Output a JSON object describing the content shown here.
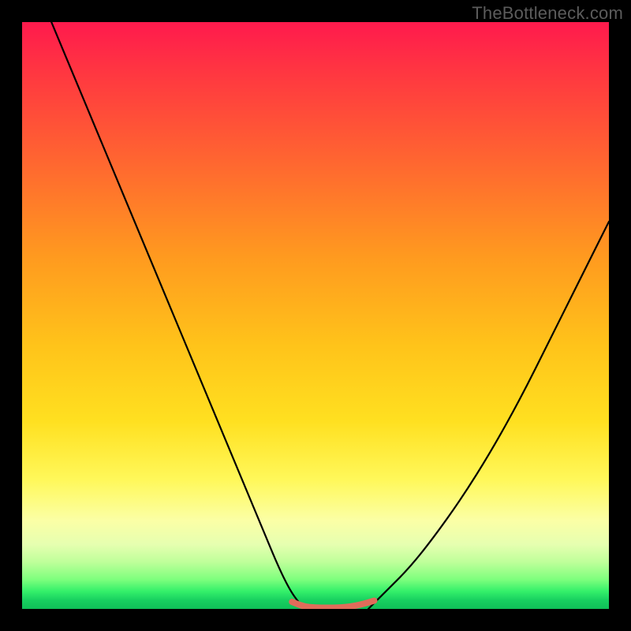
{
  "watermark": "TheBottleneck.com",
  "chart_data": {
    "type": "line",
    "title": "",
    "xlabel": "",
    "ylabel": "",
    "xlim": [
      0,
      100
    ],
    "ylim": [
      0,
      100
    ],
    "grid": false,
    "legend": false,
    "series": [
      {
        "name": "left-curve",
        "color": "#000000",
        "x": [
          5,
          10,
          15,
          20,
          25,
          30,
          35,
          40,
          45,
          48
        ],
        "values": [
          100,
          88,
          76,
          64,
          52,
          40,
          28,
          16,
          4,
          0
        ]
      },
      {
        "name": "right-curve",
        "color": "#000000",
        "x": [
          59,
          62,
          66,
          70,
          75,
          80,
          85,
          90,
          95,
          100
        ],
        "values": [
          0,
          3,
          7,
          12,
          19,
          27,
          36,
          46,
          56,
          66
        ]
      },
      {
        "name": "bottom-band",
        "color": "#e06c5a",
        "x": [
          46,
          48,
          50,
          52,
          54,
          56,
          58,
          60
        ],
        "values": [
          1.2,
          0.4,
          0.2,
          0.2,
          0.2,
          0.4,
          0.8,
          1.4
        ]
      }
    ],
    "background_gradient": {
      "stops": [
        {
          "pos": 0,
          "color": "#ff1a4d"
        },
        {
          "pos": 0.25,
          "color": "#ff6a2f"
        },
        {
          "pos": 0.55,
          "color": "#ffc31a"
        },
        {
          "pos": 0.78,
          "color": "#fff85a"
        },
        {
          "pos": 0.92,
          "color": "#bfff9a"
        },
        {
          "pos": 1.0,
          "color": "#0fbf58"
        }
      ]
    }
  }
}
